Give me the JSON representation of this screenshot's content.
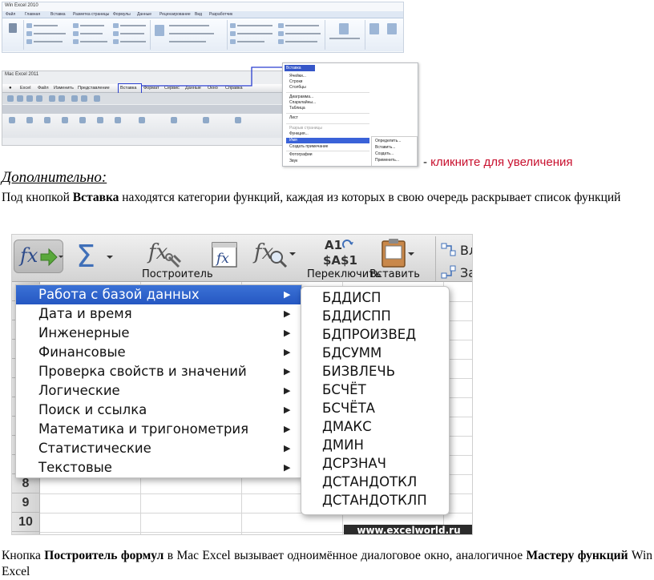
{
  "win_thumb": {
    "caption": "Win Excel 2010",
    "tabs": [
      "Файл",
      "Главная",
      "Вставка",
      "Разметка страницы",
      "Формулы",
      "Данные",
      "Рецензирование",
      "Вид",
      "Разработчик"
    ]
  },
  "mac_thumb": {
    "caption": "Mac Excel 2011",
    "menubar": [
      "Excel",
      "Файл",
      "Изменить",
      "Представление",
      "Вставка",
      "Формат",
      "Сервис",
      "Данные",
      "Окно",
      "Справка"
    ],
    "menu_header": "Вставка",
    "menu_items": [
      "Ячейки...",
      "Строки",
      "Столбцы",
      "Диаграмма...",
      "Спарклайны...",
      "Таблица",
      "Лист",
      "Разрыв страницы",
      "Функция...",
      "Имя",
      "Создать примечание",
      "Фотографии",
      "Звук"
    ],
    "submenu_items": [
      "Определить...",
      "Вставить...",
      "Создать...",
      "Применить..."
    ]
  },
  "enlarge_link": {
    "dash": "-",
    "text": "кликните для увеличения"
  },
  "extra_heading": "Дополнительно:",
  "para1": {
    "a": "Под кнопкой ",
    "b": "Вставка",
    "c": " находятся категории функций, каждая из которых в свою очередь раскрывает список функций"
  },
  "toolbar": {
    "builder_label": "Построитель",
    "ref_icon_top": "A1",
    "ref_icon_bottom": "$A$1",
    "ref_label": "Переключить",
    "insert_label": "Вставить",
    "side_label_1": "Вл",
    "side_label_2": "За"
  },
  "row_numbers": [
    "8",
    "9",
    "10"
  ],
  "function_categories": [
    "Работа с базой данных",
    "Дата и время",
    "Инженерные",
    "Финансовые",
    "Проверка свойств и значений",
    "Логические",
    "Поиск и ссылка",
    "Математика и тригонометрия",
    "Статистические",
    "Текстовые"
  ],
  "selected_category": "Работа с базой данных",
  "database_functions": [
    "БДДИСП",
    "БДДИСПП",
    "БДПРОИЗВЕД",
    "БДСУММ",
    "БИЗВЛЕЧЬ",
    "БСЧЁТ",
    "БСЧЁТА",
    "ДМАКС",
    "ДМИН",
    "ДСРЗНАЧ",
    "ДСТАНДОТКЛ",
    "ДСТАНДОТКЛП"
  ],
  "watermark": "www.excelworld.ru",
  "para2": {
    "a": "Кнопка ",
    "b": "Построитель формул",
    "c": " в Mac Excel вызывает одноимённое диалоговое окно, аналогичное ",
    "d": "Мастеру функций",
    "e": " Win Excel"
  },
  "colors": {
    "menu_highlight": "#2a5fc9",
    "link_red": "#c8102e",
    "connector_blue": "#2a3fd0"
  }
}
